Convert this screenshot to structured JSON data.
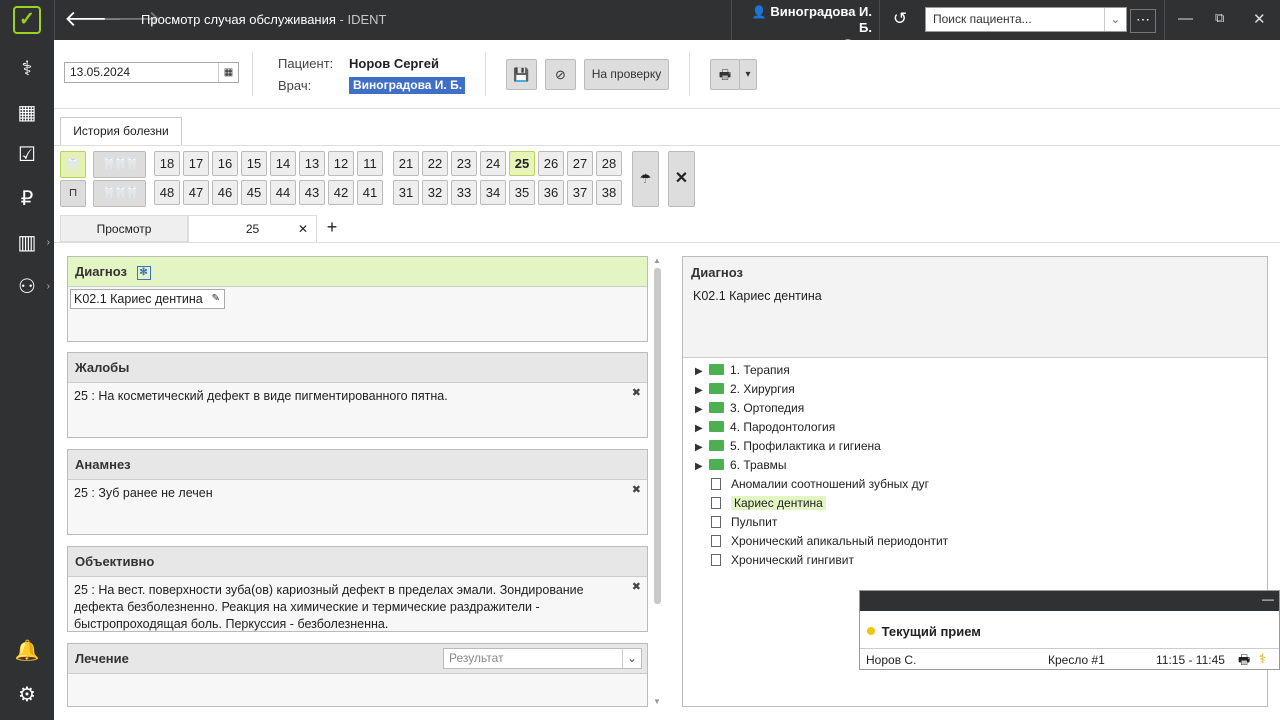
{
  "window": {
    "title": "Просмотр случая обслуживания",
    "app": "IDENT",
    "user_name": "Виноградова И. Б.",
    "user_role": "Врач",
    "search_placeholder": "Поиск пациента..."
  },
  "form": {
    "date": "13.05.2024",
    "patient_label": "Пациент:",
    "patient_value": "Норов Сергей",
    "doctor_label": "Врач:",
    "doctor_value": "Виноградова И. Б.",
    "review_button": "На проверку"
  },
  "tabs": {
    "history": "История болезни",
    "view": "Просмотр",
    "tooth": "25"
  },
  "teeth": {
    "upper_right": [
      "18",
      "17",
      "16",
      "15",
      "14",
      "13",
      "12",
      "11"
    ],
    "upper_left": [
      "21",
      "22",
      "23",
      "24",
      "25",
      "26",
      "27",
      "28"
    ],
    "lower_right": [
      "48",
      "47",
      "46",
      "45",
      "44",
      "43",
      "42",
      "41"
    ],
    "lower_left": [
      "31",
      "32",
      "33",
      "34",
      "35",
      "36",
      "37",
      "38"
    ],
    "selected": "25"
  },
  "sections": {
    "diagnosis": {
      "title": "Диагноз",
      "chip": "K02.1 Кариес дентина"
    },
    "complaints": {
      "title": "Жалобы",
      "text": "25 : На косметический дефект в виде пигментированного пятна."
    },
    "anamnesis": {
      "title": "Анамнез",
      "text": "25 : Зуб ранее не лечен"
    },
    "objective": {
      "title": "Объективно",
      "text": "25 : На вест. поверхности зуба(ов) кариозный дефект в пределах эмали. Зондирование дефекта безболезненно. Реакция на химические и термические раздражители - быстропроходящая боль. Перкуссия - безболезненна."
    },
    "treatment": {
      "title": "Лечение",
      "result_placeholder": "Результат"
    }
  },
  "right_panel": {
    "title": "Диагноз",
    "value": "K02.1 Кариес дентина",
    "folders": [
      "1. Терапия",
      "2. Хирургия",
      "3. Ортопедия",
      "4. Пародонтология",
      "5. Профилактика и гигиена",
      "6. Травмы"
    ],
    "items": [
      "Аномалии соотношений зубных дуг",
      "Кариес дентина",
      "Пульпит",
      "Хронический апикальный периодонтит",
      "Хронический гингивит"
    ],
    "highlighted": "Кариес дентина"
  },
  "popup": {
    "title": "Текущий прием",
    "patient": "Норов С.",
    "chair": "Кресло #1",
    "time": "11:15 - 11:45"
  },
  "colors": {
    "accent": "#9bd21c",
    "selection": "#3f6fc6",
    "highlight": "#e4f5c4",
    "dark": "#2f3133"
  }
}
